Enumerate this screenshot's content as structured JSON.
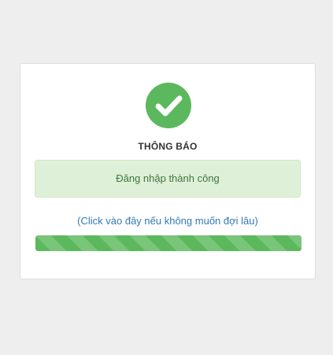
{
  "dialog": {
    "icon": "check-circle-icon",
    "title": "THÔNG BÁO",
    "message": "Đăng nhập thành công",
    "link_text": "(Click vào đây nếu không muốn đợi lâu)",
    "progress_percent": 100
  },
  "colors": {
    "page_background": "#eeeeee",
    "success_green": "#5cb85c",
    "alert_background": "#dff0d8",
    "alert_text": "#3c763d",
    "link": "#337ab7"
  }
}
